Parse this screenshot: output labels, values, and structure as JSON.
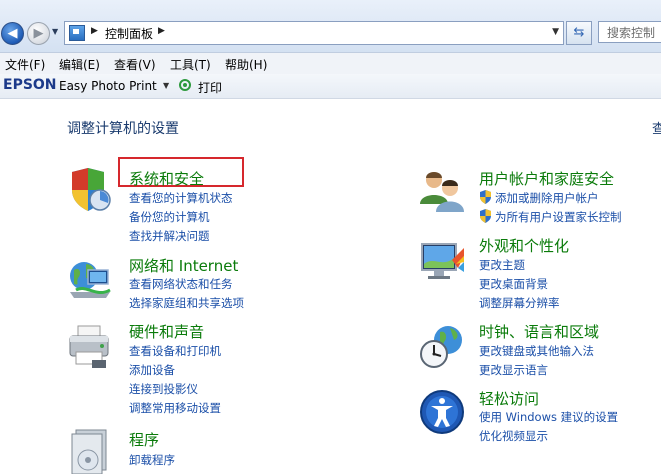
{
  "address_bar": {
    "back_glyph": "◀",
    "forward_glyph": "▶",
    "breadcrumb": "控制面板",
    "search_placeholder": "搜索控制"
  },
  "menu": {
    "file": "文件(F)",
    "edit": "编辑(E)",
    "view": "查看(V)",
    "tools": "工具(T)",
    "help": "帮助(H)"
  },
  "epson_toolbar": {
    "logo": "EPSON",
    "app": "Easy Photo Print",
    "print": "打印"
  },
  "main": {
    "title": "调整计算机的设置",
    "view_by": "查"
  },
  "left_categories": [
    {
      "title": "系统和安全",
      "links": [
        "查看您的计算机状态",
        "备份您的计算机",
        "查找并解决问题"
      ]
    },
    {
      "title": "网络和 Internet",
      "links": [
        "查看网络状态和任务",
        "选择家庭组和共享选项"
      ]
    },
    {
      "title": "硬件和声音",
      "links": [
        "查看设备和打印机",
        "添加设备",
        "连接到投影仪",
        "调整常用移动设置"
      ]
    },
    {
      "title": "程序",
      "links": [
        "卸载程序"
      ]
    }
  ],
  "right_categories": [
    {
      "title": "用户帐户和家庭安全",
      "links": [
        "添加或删除用户帐户",
        "为所有用户设置家长控制"
      ]
    },
    {
      "title": "外观和个性化",
      "links": [
        "更改主题",
        "更改桌面背景",
        "调整屏幕分辨率"
      ]
    },
    {
      "title": "时钟、语言和区域",
      "links": [
        "更改键盘或其他输入法",
        "更改显示语言"
      ]
    },
    {
      "title": "轻松访问",
      "links": [
        "使用 Windows 建议的设置",
        "优化视频显示"
      ]
    }
  ],
  "colors": {
    "category_title": "#0a7b0a",
    "link": "#1b4fa8",
    "highlight": "#d6282d"
  }
}
